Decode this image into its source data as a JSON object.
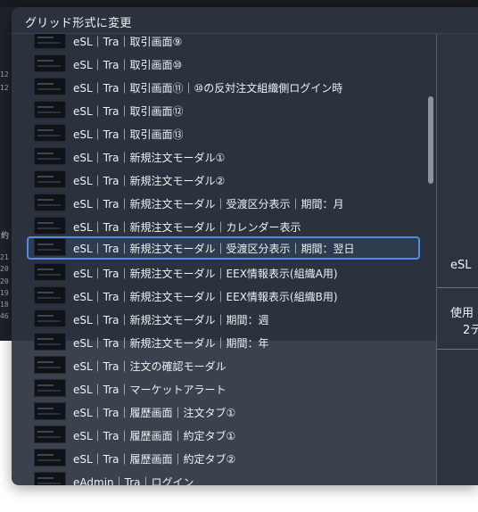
{
  "overlay": {
    "title": "グリッド形式に変更"
  },
  "items": [
    {
      "label": "eSL｜Tra｜取引画面⑨"
    },
    {
      "label": "eSL｜Tra｜取引画面⑩"
    },
    {
      "label": "eSL｜Tra｜取引画面⑪｜⑩の反対注文組織側ログイン時"
    },
    {
      "label": "eSL｜Tra｜取引画面⑫"
    },
    {
      "label": "eSL｜Tra｜取引画面⑬"
    },
    {
      "label": "eSL｜Tra｜新規注文モーダル①"
    },
    {
      "label": "eSL｜Tra｜新規注文モーダル②"
    },
    {
      "label": "eSL｜Tra｜新規注文モーダル｜受渡区分表示｜期間：月"
    },
    {
      "label": "eSL｜Tra｜新規注文モーダル｜カレンダー表示"
    },
    {
      "label": "eSL｜Tra｜新規注文モーダル｜受渡区分表示｜期間：翌日",
      "selected": true
    },
    {
      "label": "eSL｜Tra｜新規注文モーダル｜EEX情報表示(組織A用)"
    },
    {
      "label": "eSL｜Tra｜新規注文モーダル｜EEX情報表示(組織B用)"
    },
    {
      "label": "eSL｜Tra｜新規注文モーダル｜期間：週"
    },
    {
      "label": "eSL｜Tra｜新規注文モーダル｜期間：年"
    },
    {
      "label": "eSL｜Tra｜注文の確認モーダル"
    },
    {
      "label": "eSL｜Tra｜マーケットアラート"
    },
    {
      "label": "eSL｜Tra｜履歴画面｜注文タブ①"
    },
    {
      "label": "eSL｜Tra｜履歴画面｜約定タブ①"
    },
    {
      "label": "eSL｜Tra｜履歴画面｜約定タブ②"
    },
    {
      "label": "eAdmin｜Tra｜ログイン"
    }
  ],
  "right_panel": {
    "label_1": "eSL",
    "label_2": "使用",
    "label_3": "2テ"
  },
  "background": {
    "numbers": [
      "12",
      "12",
      "21",
      "20",
      "20",
      "19",
      "18",
      "46"
    ],
    "label": "約"
  },
  "colors": {
    "overlay_bg": "#2c3440",
    "selection_border": "#4d8fe6",
    "text": "#eef1f4"
  }
}
